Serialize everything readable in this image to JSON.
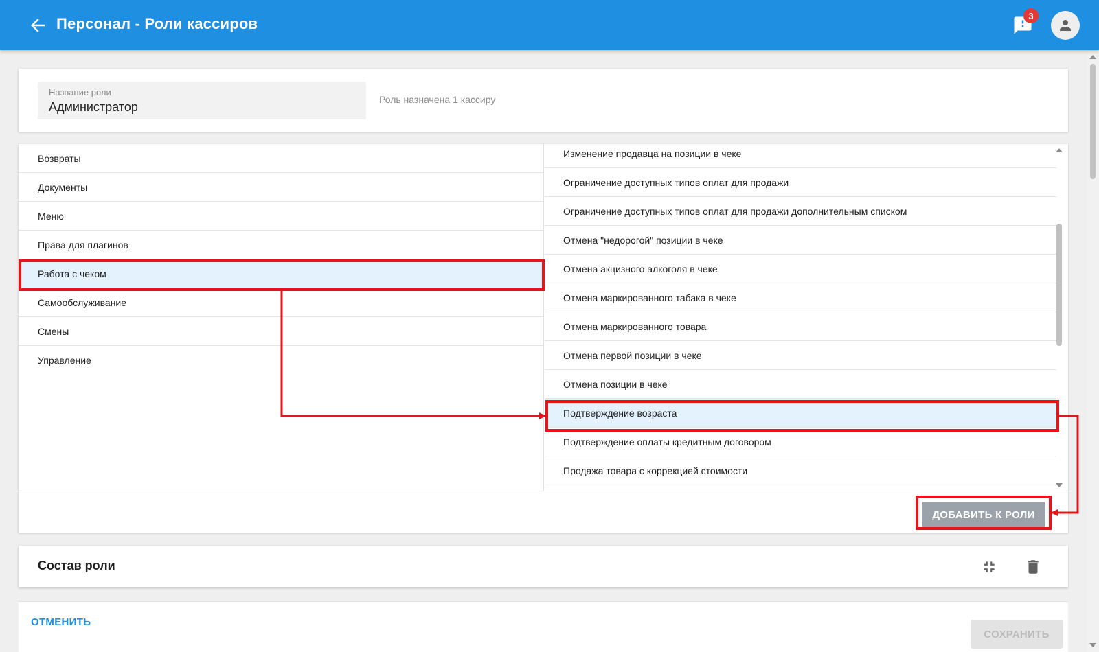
{
  "header": {
    "title": "Персонал - Роли кассиров",
    "notification_count": "3"
  },
  "role": {
    "field_label": "Название роли",
    "field_value": "Администратор",
    "assigned_text": "Роль назначена 1 кассиру"
  },
  "categories": [
    "Возвраты",
    "Документы",
    "Меню",
    "Права для плагинов",
    "Работа с чеком",
    "Самообслуживание",
    "Смены",
    "Управление"
  ],
  "selected_category": "Работа с чеком",
  "permissions": [
    "Изменение продавца на позиции в чеке",
    "Ограничение доступных типов оплат для продажи",
    "Ограничение доступных типов оплат для продажи дополнительным списком",
    "Отмена \"недорогой\" позиции в чеке",
    "Отмена акцизного алкоголя в чеке",
    "Отмена маркированного табака в чеке",
    "Отмена маркированного товара",
    "Отмена первой позиции в чеке",
    "Отмена позиции в чеке",
    "Подтверждение возраста",
    "Подтверждение оплаты кредитным договором",
    "Продажа товара с коррекцией стоимости"
  ],
  "selected_permission": "Подтверждение возраста",
  "add_button_label": "ДОБАВИТЬ К РОЛИ",
  "composition": {
    "title": "Состав роли"
  },
  "footer": {
    "cancel_label": "ОТМЕНИТЬ",
    "save_label": "СОХРАНИТЬ"
  },
  "colors": {
    "primary": "#1e8fe1",
    "selection_bg": "#e3f2fc",
    "annotation": "#e8141a"
  },
  "icons": [
    "back-arrow-icon",
    "notification-icon",
    "account-icon",
    "collapse-icon",
    "delete-icon"
  ]
}
